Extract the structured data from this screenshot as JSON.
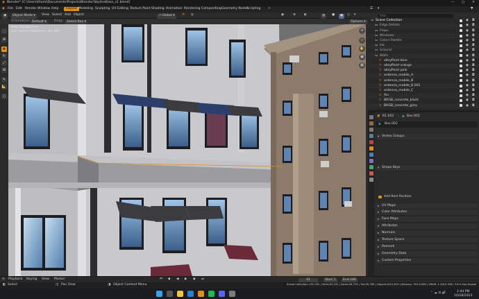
{
  "title": "Blender* [C:\\Users\\thomi\\Documents\\Projects\\Blender\\SkylineBase_v1.blend]",
  "menu": {
    "items": [
      "File",
      "Edit",
      "Render",
      "Window",
      "Help"
    ],
    "workspaces": [
      "Layout",
      "Modeling",
      "Sculpting",
      "UV Editing",
      "Texture Paint",
      "Shading",
      "Animation",
      "Rendering",
      "Compositing",
      "Geometry Nodes",
      "Scripting"
    ],
    "active_workspace": "Layout",
    "scene_label": "Scene",
    "viewlayer_label": "Color"
  },
  "viewport_header": {
    "mode": "Object Mode",
    "items": [
      "View",
      "Select",
      "Add",
      "Object"
    ],
    "transform": "Global",
    "orientation_label": "Orientation:",
    "orientation_value": "Default",
    "drag_label": "Drag:",
    "drag_value": "Select Box",
    "options": "Options"
  },
  "viewport_overlay": {
    "line1": "User Perspective",
    "line2": "(41) Scene Collection | B1.002"
  },
  "outliner": {
    "header": "Scene Collection",
    "search_placeholder": "Filter",
    "rows": [
      {
        "label": "Scene Collection",
        "color": "#ffffff"
      },
      {
        "label": "Edge Details",
        "color": "#a8a8a8"
      },
      {
        "label": "Props",
        "color": "#a8a8a8"
      },
      {
        "label": "Windows",
        "color": "#a8a8a8"
      },
      {
        "label": "Colors Palette",
        "color": "#a8a8a8"
      },
      {
        "label": "Ink",
        "color": "#a8a8a8"
      },
      {
        "label": "Ground",
        "color": "#a8a8a8"
      },
      {
        "label": "Walls",
        "color": "#a8a8a8"
      },
      {
        "label": "alleyPoint blue",
        "color": "#d9d9d9"
      },
      {
        "label": "alleyPoint orange",
        "color": "#d9d9d9"
      },
      {
        "label": "alleyPoint pink",
        "color": "#d9d9d9"
      },
      {
        "label": "antenna_mobile_A",
        "color": "#d9d9d9"
      },
      {
        "label": "antenna_mobile_B",
        "color": "#d9d9d9"
      },
      {
        "label": "antenna_mobile_B.001",
        "color": "#d9d9d9"
      },
      {
        "label": "antenna_mobile_C",
        "color": "#d9d9d9"
      },
      {
        "label": "Arc",
        "color": "#d9d9d9"
      },
      {
        "label": "BRGB_concrete_black",
        "color": "#d9d9d9"
      },
      {
        "label": "BRGB_concrete_grey",
        "color": "#d9d9d9"
      }
    ]
  },
  "properties": {
    "breadcrumb_object": "B1.002",
    "breadcrumb_mesh": "Box.002",
    "mesh_name": "Box.002",
    "sections": [
      {
        "label": "Vertex Groups"
      },
      {
        "label": "Shape Keys"
      },
      {
        "label": "UV Maps"
      },
      {
        "label": "Color Attributes"
      },
      {
        "label": "Face Maps"
      },
      {
        "label": "Attributes"
      },
      {
        "label": "Normals"
      },
      {
        "label": "Texture Space"
      },
      {
        "label": "Remesh"
      },
      {
        "label": "Geometry Data"
      },
      {
        "label": "Custom Properties"
      }
    ],
    "add_rest_position": "Add Rest Position"
  },
  "timeline": {
    "items": [
      "Playback",
      "Keying",
      "View",
      "Marker"
    ],
    "current_frame": "41",
    "start_label": "Start",
    "start_value": "1",
    "end_label": "End",
    "end_value": "180"
  },
  "statusbar": {
    "left": [
      "Select",
      "Pan View",
      "Object Context Menu"
    ],
    "right": "Scene Collection | B1.002 | Verts:63,152 | Faces:49,729 | Tris:99,785 | Objects:0/12,619 | Memory: 353.6 MiB | VRAM: 1.5/8.0 GiB | 3.6.0 Geo Engine"
  },
  "taskbar": {
    "time": "2:44 PM",
    "date": "10/28/2023"
  }
}
